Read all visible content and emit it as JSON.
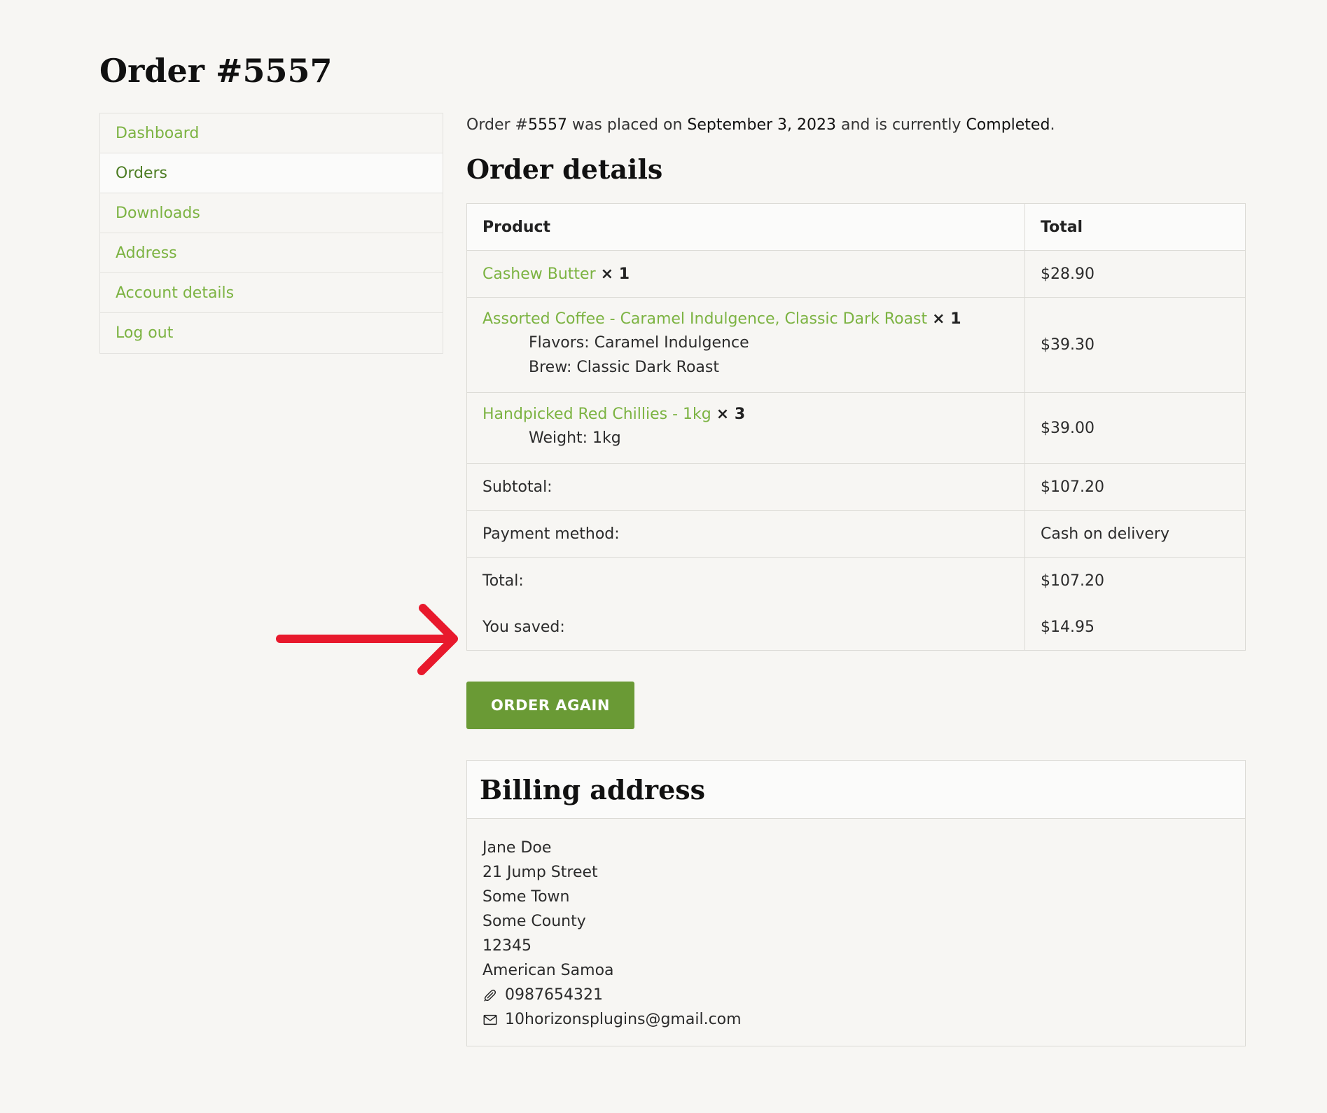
{
  "page": {
    "title": "Order #5557"
  },
  "nav": {
    "items": [
      {
        "label": "Dashboard"
      },
      {
        "label": "Orders"
      },
      {
        "label": "Downloads"
      },
      {
        "label": "Address"
      },
      {
        "label": "Account details"
      },
      {
        "label": "Log out"
      }
    ],
    "active": "Orders"
  },
  "order": {
    "status_prefix": "Order #",
    "number": "5557",
    "placed_text": " was placed on ",
    "date": "September 3, 2023",
    "status_text": " and is currently ",
    "status": "Completed",
    "status_suffix": "."
  },
  "details": {
    "heading": "Order details",
    "col_product": "Product",
    "col_total": "Total",
    "items": [
      {
        "name": "Cashew Butter",
        "qty": "× 1",
        "meta": [],
        "total": "$28.90"
      },
      {
        "name": "Assorted Coffee - Caramel Indulgence, Classic Dark Roast",
        "qty": "× 1",
        "meta": [
          "Flavors: Caramel Indulgence",
          "Brew: Classic Dark Roast"
        ],
        "total": "$39.30"
      },
      {
        "name": "Handpicked Red Chillies - 1kg",
        "qty": "× 3",
        "meta": [
          "Weight: 1kg"
        ],
        "total": "$39.00"
      }
    ],
    "subtotal_label": "Subtotal:",
    "subtotal_value": "$107.20",
    "payment_label": "Payment method:",
    "payment_value": "Cash on delivery",
    "total_label": "Total:",
    "total_value": "$107.20",
    "saved_label": "You saved:",
    "saved_value": "$14.95"
  },
  "actions": {
    "order_again": "ORDER AGAIN"
  },
  "billing": {
    "heading": "Billing address",
    "name": "Jane Doe",
    "street": "21 Jump Street",
    "town": "Some Town",
    "county": "Some County",
    "postcode": "12345",
    "country": "American Samoa",
    "phone": "0987654321",
    "email": "10horizonsplugins@gmail.com"
  },
  "colors": {
    "link": "#7cb342",
    "link_active": "#4e7e25",
    "button": "#6a9a35",
    "annotation_arrow": "#e8192c",
    "background": "#f7f6f3"
  },
  "icons": {
    "phone": "phone-icon",
    "email": "envelope-icon",
    "annotation": "red-arrow-icon"
  }
}
